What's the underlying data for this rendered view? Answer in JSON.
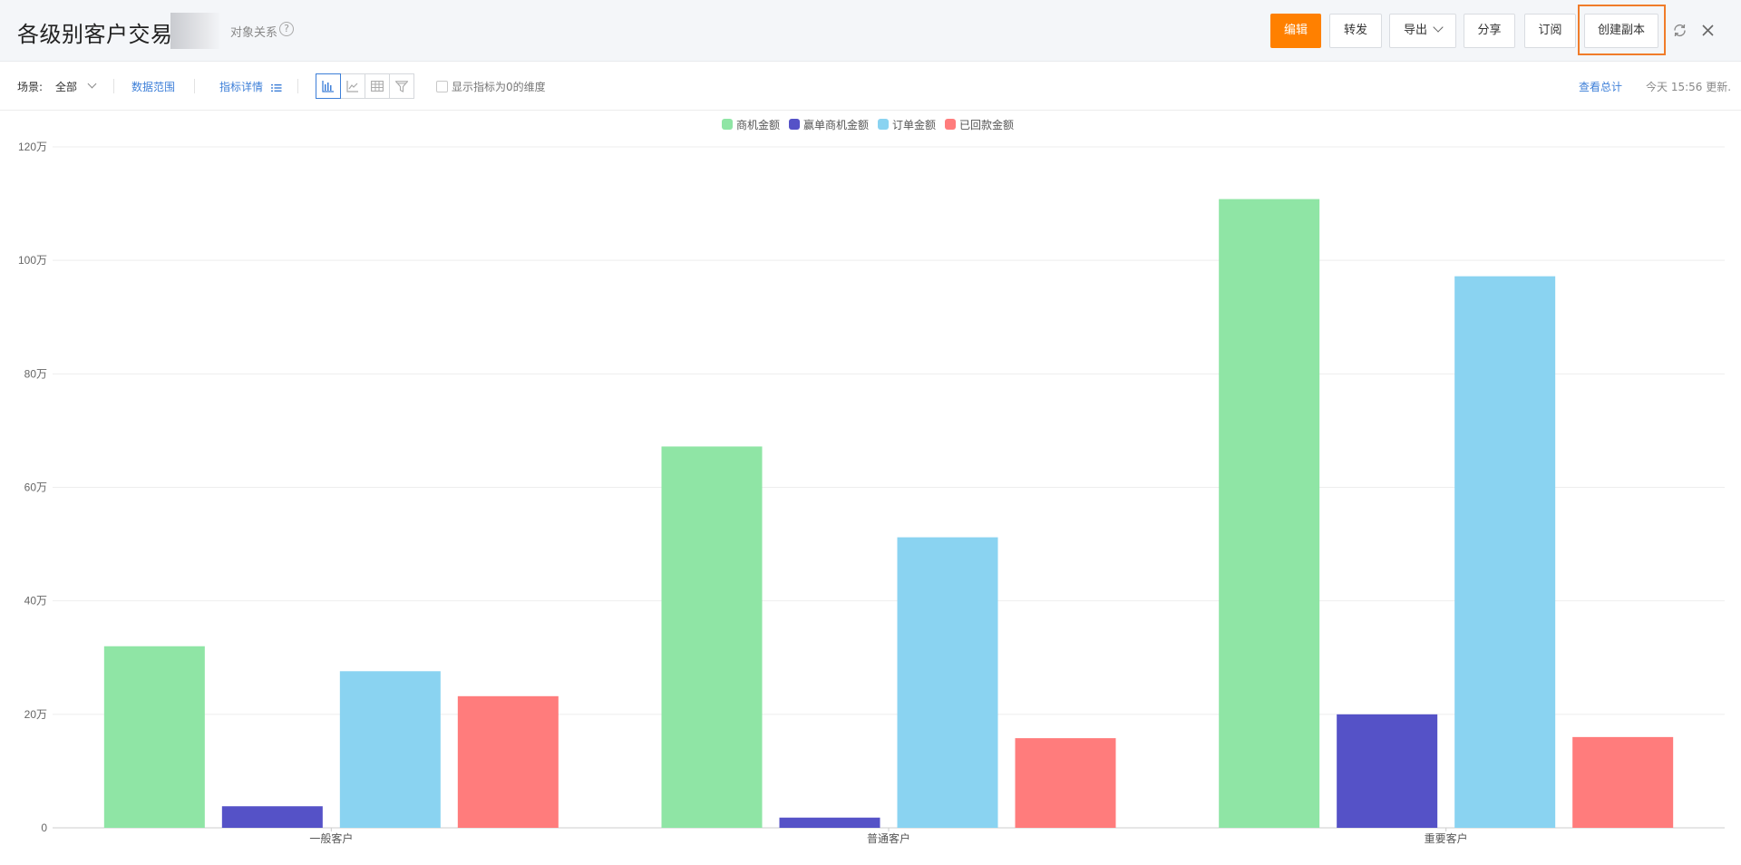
{
  "header": {
    "title": "各级别客户交易情",
    "subtitle": "对象关系",
    "help_glyph": "?",
    "buttons": {
      "edit": "编辑",
      "forward": "转发",
      "export": "导出",
      "share": "分享",
      "subscribe": "订阅",
      "create_copy": "创建副本"
    }
  },
  "toolbar": {
    "scene_label": "场景:",
    "scene_value": "全部",
    "data_range": "数据范围",
    "metric_details": "指标详情",
    "show_zero_label": "显示指标为0的维度",
    "view_totals": "查看总计",
    "updated": "今天 15:56 更新."
  },
  "colors": {
    "accent": "#ff8000",
    "link": "#3d7fd8",
    "highlight_border": "#f07c2a"
  },
  "chart_data": {
    "type": "bar",
    "categories": [
      "一般客户",
      "普通客户",
      "重要客户"
    ],
    "series": [
      {
        "name": "商机金额",
        "color": "#8fe5a5",
        "values": [
          320000,
          672000,
          1108000
        ]
      },
      {
        "name": "赢单商机金额",
        "color": "#5552c7",
        "values": [
          38000,
          18000,
          200000
        ]
      },
      {
        "name": "订单金额",
        "color": "#8ad3f1",
        "values": [
          276000,
          512000,
          972000
        ]
      },
      {
        "name": "已回款金额",
        "color": "#ff7c7c",
        "values": [
          232000,
          158000,
          160000
        ]
      }
    ],
    "ylim": [
      0,
      1200000
    ],
    "yticks": [
      {
        "value": 0,
        "label": "0"
      },
      {
        "value": 200000,
        "label": "20万"
      },
      {
        "value": 400000,
        "label": "40万"
      },
      {
        "value": 600000,
        "label": "60万"
      },
      {
        "value": 800000,
        "label": "80万"
      },
      {
        "value": 1000000,
        "label": "100万"
      },
      {
        "value": 1200000,
        "label": "120万"
      }
    ],
    "legend_position": "top-center",
    "grid": true
  }
}
